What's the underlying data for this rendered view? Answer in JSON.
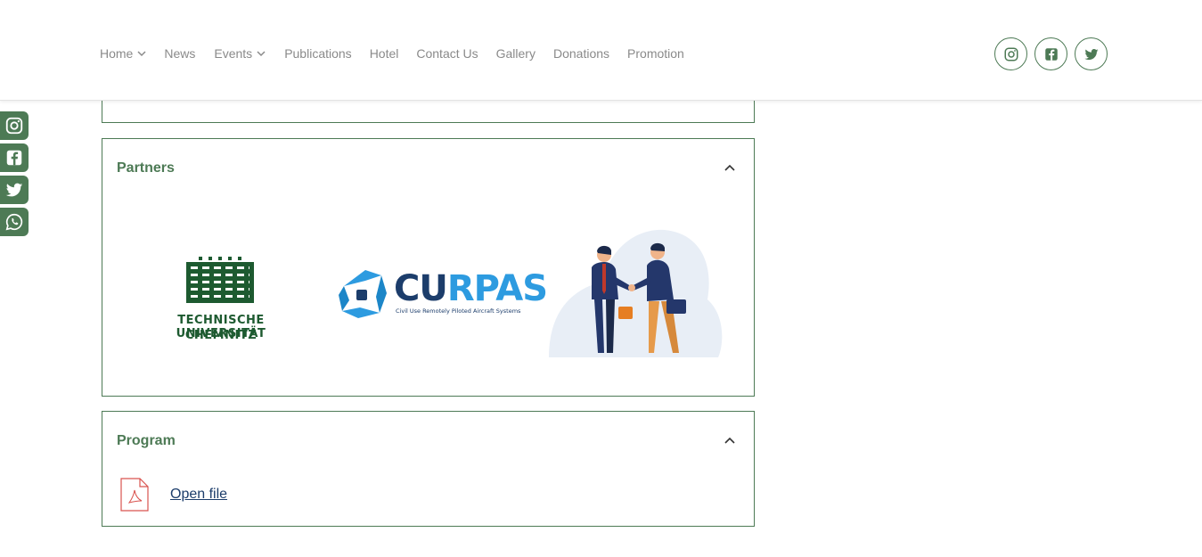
{
  "nav": {
    "items": [
      {
        "label": "Home",
        "dropdown": true
      },
      {
        "label": "News",
        "dropdown": false
      },
      {
        "label": "Events",
        "dropdown": true
      },
      {
        "label": "Publications",
        "dropdown": false
      },
      {
        "label": "Hotel",
        "dropdown": false
      },
      {
        "label": "Contact Us",
        "dropdown": false
      },
      {
        "label": "Gallery",
        "dropdown": false
      },
      {
        "label": "Donations",
        "dropdown": false
      },
      {
        "label": "Promotion",
        "dropdown": false
      }
    ]
  },
  "header_social": [
    "instagram-icon",
    "facebook-icon",
    "twitter-icon"
  ],
  "side_social": [
    "instagram-icon",
    "facebook-icon",
    "twitter-icon",
    "whatsapp-icon"
  ],
  "partners": {
    "title": "Partners",
    "logos": {
      "tuc_line1": "TECHNISCHE UNIVERSITÄT",
      "tuc_line2": "CHEMNITZ",
      "curpas_cu": "CU",
      "curpas_rpas": "RPAS",
      "curpas_sub": "Civil Use Remotely Piloted Aircraft Systems"
    }
  },
  "program": {
    "title": "Program",
    "file_link": "Open file"
  },
  "colors": {
    "accent": "#4d7a55",
    "nav_text": "#8a8a8a",
    "link": "#1c3d6b",
    "pdf_red": "#d9534f"
  }
}
